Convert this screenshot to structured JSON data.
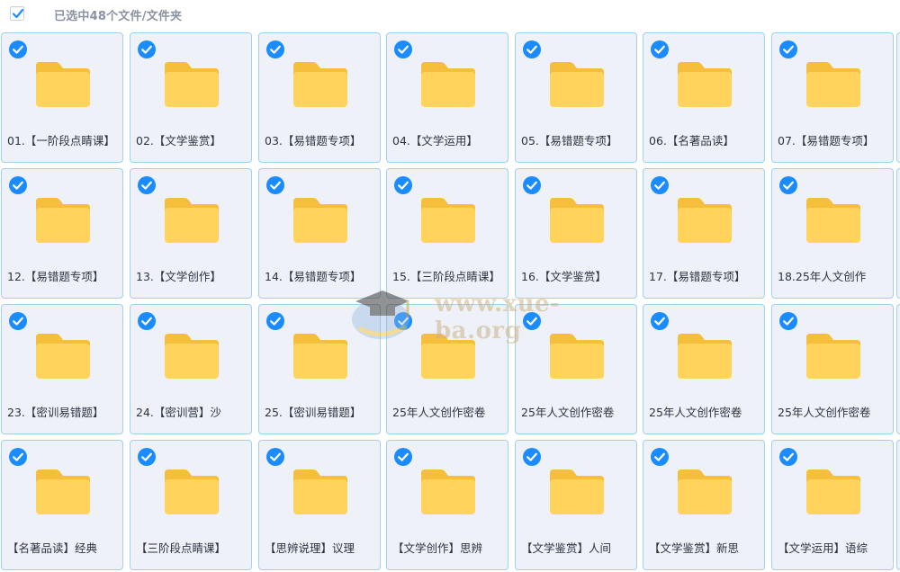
{
  "selection": {
    "checked": true,
    "label": "已选中48个文件/文件夹"
  },
  "colors": {
    "accent": "#1a8cff",
    "tile_bg": "#eef2f8",
    "tile_border": "#9fd0ef",
    "folder_front": "#ffd35c",
    "folder_back": "#f5bf3c"
  },
  "watermark": {
    "text": "www.xue-ba.org"
  },
  "files": [
    {
      "name": "01.【一阶段点睛课】"
    },
    {
      "name": "02.【文学鉴赏】"
    },
    {
      "name": "03.【易错题专项】"
    },
    {
      "name": "04.【文学运用】"
    },
    {
      "name": "05.【易错题专项】"
    },
    {
      "name": "06.【名著品读】"
    },
    {
      "name": "07.【易错题专项】"
    },
    {
      "name": "12.【易错题专项】"
    },
    {
      "name": "13.【文学创作】"
    },
    {
      "name": "14.【易错题专项】"
    },
    {
      "name": "15.【三阶段点睛课】"
    },
    {
      "name": "16.【文学鉴赏】"
    },
    {
      "name": "17.【易错题专项】"
    },
    {
      "name": "18.25年人文创作"
    },
    {
      "name": "23.【密训易错题】"
    },
    {
      "name": "24.【密训营】沙"
    },
    {
      "name": "25.【密训易错题】"
    },
    {
      "name": "25年人文创作密卷"
    },
    {
      "name": "25年人文创作密卷"
    },
    {
      "name": "25年人文创作密卷"
    },
    {
      "name": "25年人文创作密卷"
    },
    {
      "name": "【名著品读】经典"
    },
    {
      "name": "【三阶段点睛课】"
    },
    {
      "name": "【思辨说理】议理"
    },
    {
      "name": "【文学创作】思辨"
    },
    {
      "name": "【文学鉴赏】人间"
    },
    {
      "name": "【文学鉴赏】新思"
    },
    {
      "name": "【文学运用】语综"
    }
  ]
}
